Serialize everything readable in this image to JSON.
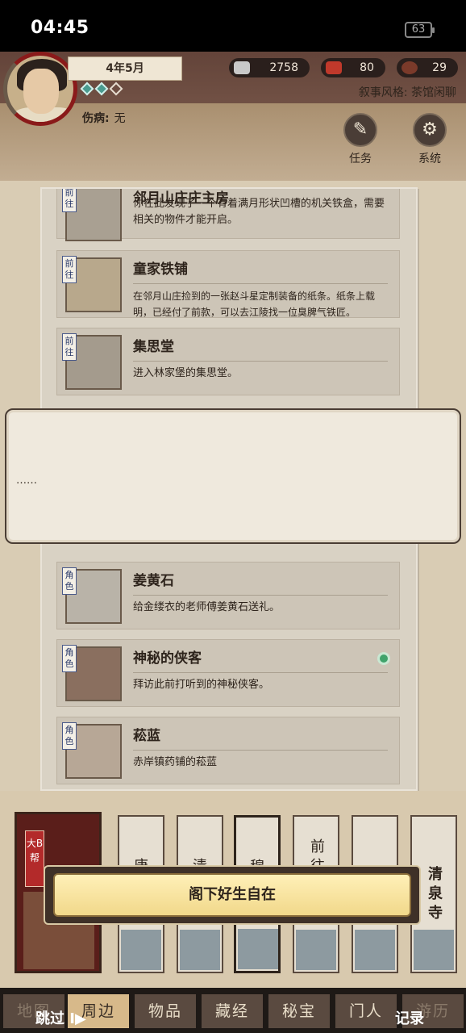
{
  "status_bar": {
    "time": "04:45",
    "battery": "63"
  },
  "header": {
    "date": "4年5月",
    "injury_label": "伤病:",
    "injury_value": "无",
    "silver": "2758",
    "reputation": "80",
    "third_resource": "29",
    "narrative_style": "叙事风格: 茶馆闲聊",
    "tasks_label": "任务",
    "system_label": "系统"
  },
  "cards": [
    {
      "tag": "前往",
      "title": "邻月山庄庄主房",
      "desc": "你在此发现了一个有着满月形状凹槽的机关铁盒，需要相关的物件才能开启。"
    },
    {
      "tag": "前往",
      "title": "童家铁铺",
      "desc": "在邻月山庄捡到的一张赵斗星定制装备的纸条。纸条上载明，已经付了前款，可以去江陵找一位臭脾气铁匠。"
    },
    {
      "tag": "前往",
      "title": "集思堂",
      "desc": "进入林家堡的集思堂。"
    },
    {
      "tag": "角色",
      "title": "姜黄石",
      "desc": "给金缕衣的老师傅姜黄石送礼。"
    },
    {
      "tag": "角色",
      "title": "神秘的侠客",
      "desc": "拜访此前打听到的神秘侠客。"
    },
    {
      "tag": "角色",
      "title": "菘蓝",
      "desc": "赤岸镇药铺的菘蓝"
    }
  ],
  "dialog": {
    "text": "……"
  },
  "map": {
    "badge": "大B帮"
  },
  "locations": [
    {
      "name": "唐"
    },
    {
      "name": "清"
    },
    {
      "name": "穆"
    },
    {
      "name": "前往"
    },
    {
      "name": ""
    },
    {
      "name": "清泉寺"
    }
  ],
  "say_button": "阁下好生自在",
  "tabs": [
    "地图",
    "周边",
    "物品",
    "藏经",
    "秘宝",
    "门人",
    "游历"
  ],
  "skip_label": "跳过 I▶",
  "record_label": "记录"
}
